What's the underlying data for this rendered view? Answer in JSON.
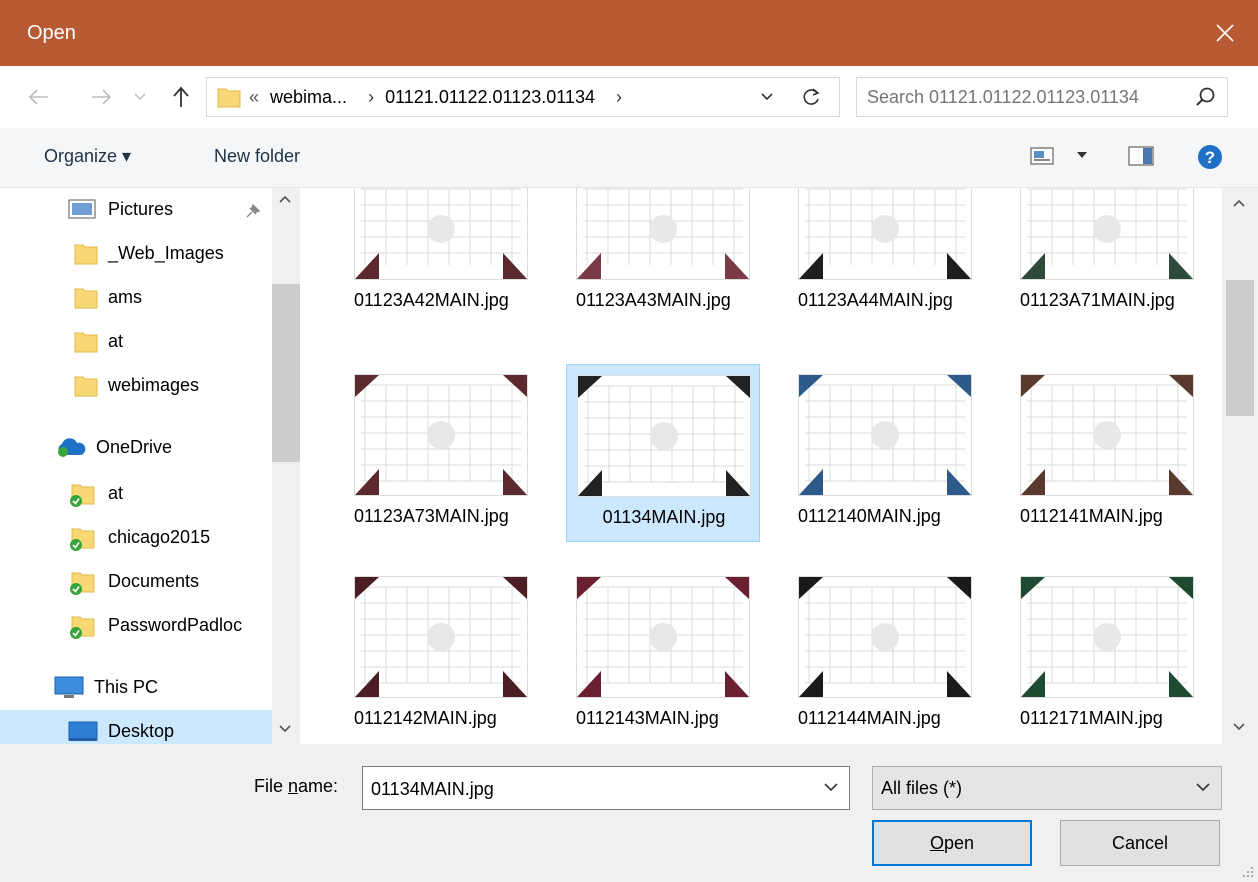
{
  "window": {
    "title": "Open"
  },
  "address": {
    "overflow": "«",
    "crumbs": [
      "webima...",
      "01121.01122.01123.01134"
    ],
    "separator": "›"
  },
  "search": {
    "placeholder": "Search 01121.01122.01123.01134"
  },
  "toolbar": {
    "organize_label": "Organize ▾",
    "new_folder_label": "New folder"
  },
  "sidebar": {
    "items": [
      {
        "label": "Pictures",
        "icon": "pictures-icon",
        "pinned": true
      },
      {
        "label": "_Web_Images",
        "icon": "folder-icon"
      },
      {
        "label": "ams",
        "icon": "folder-icon"
      },
      {
        "label": "at",
        "icon": "folder-icon"
      },
      {
        "label": "webimages",
        "icon": "folder-icon"
      },
      {
        "label": "OneDrive",
        "icon": "onedrive-icon"
      },
      {
        "label": "at",
        "icon": "synced-folder-icon"
      },
      {
        "label": "chicago2015",
        "icon": "synced-folder-icon"
      },
      {
        "label": "Documents",
        "icon": "synced-folder-icon"
      },
      {
        "label": "PasswordPadloc",
        "icon": "synced-folder-icon"
      },
      {
        "label": "This PC",
        "icon": "computer-icon"
      },
      {
        "label": "Desktop",
        "icon": "desktop-icon",
        "selected": true
      }
    ]
  },
  "files": [
    {
      "name": "01123A42MAIN.jpg",
      "corner": "#5a2a2e"
    },
    {
      "name": "01123A43MAIN.jpg",
      "corner": "#7a3a46"
    },
    {
      "name": "01123A44MAIN.jpg",
      "corner": "#1e1e1e"
    },
    {
      "name": "01123A71MAIN.jpg",
      "corner": "#2e4a3a"
    },
    {
      "name": "01123A73MAIN.jpg",
      "corner": "#5a2a2e"
    },
    {
      "name": "01134MAIN.jpg",
      "corner": "#222222",
      "selected": true
    },
    {
      "name": "0112140MAIN.jpg",
      "corner": "#2e5a8a"
    },
    {
      "name": "0112141MAIN.jpg",
      "corner": "#5a3a2e"
    },
    {
      "name": "0112142MAIN.jpg",
      "corner": "#4a1e22"
    },
    {
      "name": "0112143MAIN.jpg",
      "corner": "#6a2030"
    },
    {
      "name": "0112144MAIN.jpg",
      "corner": "#1a1a1a"
    },
    {
      "name": "0112171MAIN.jpg",
      "corner": "#1e4a30"
    }
  ],
  "filename": {
    "label_pre": "File ",
    "label_u": "n",
    "label_post": "ame:",
    "value": "01134MAIN.jpg"
  },
  "filetype": {
    "value": "All files (*)"
  },
  "buttons": {
    "open_u": "O",
    "open_rest": "pen",
    "cancel": "Cancel"
  }
}
